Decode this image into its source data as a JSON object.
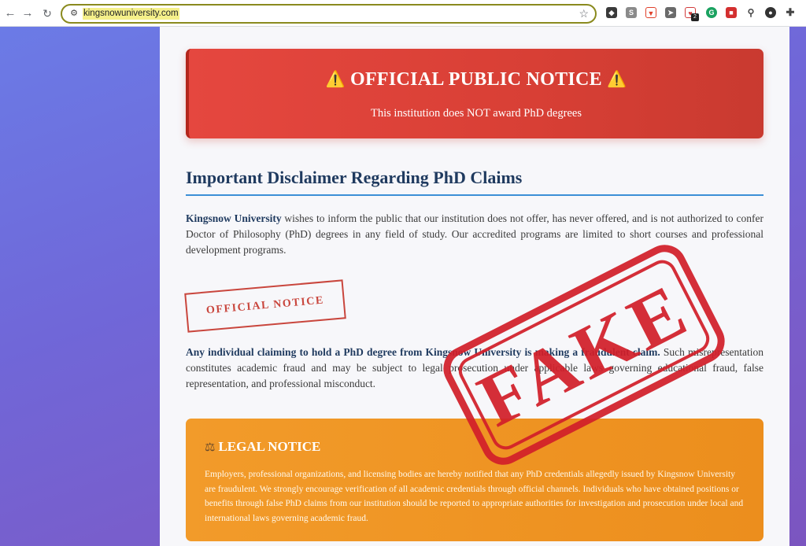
{
  "browser": {
    "url": "kingsnowuniversity.com",
    "extension_badge": "2"
  },
  "banner": {
    "title": "OFFICIAL PUBLIC NOTICE",
    "warning_glyph": "⚠️",
    "subtitle": "This institution does NOT award PhD degrees"
  },
  "disclaimer": {
    "heading": "Important Disclaimer Regarding PhD Claims",
    "para1_bold": "Kingsnow University",
    "para1_rest": " wishes to inform the public that our institution does not offer, has never offered, and is not authorized to confer Doctor of Philosophy (PhD) degrees in any field of study. Our accredited programs are limited to short courses and professional development programs.",
    "para2_bold": "Any individual claiming to hold a PhD degree from Kingsnow University is making a fraudulent claim.",
    "para2_rest": " Such misrepresentation constitutes academic fraud and may be subject to legal prosecution under applicable laws governing educational fraud, false representation, and professional misconduct."
  },
  "official_stamp": {
    "label": "OFFICIAL NOTICE"
  },
  "fake_stamp": {
    "label": "FAKE",
    "color": "#d21f2a"
  },
  "legal": {
    "icon": "scales-icon",
    "title": "LEGAL NOTICE",
    "body": "Employers, professional organizations, and licensing bodies are hereby notified that any PhD credentials allegedly issued by Kingsnow University are fraudulent. We strongly encourage verification of all academic credentials through official channels. Individuals who have obtained positions or benefits through false PhD claims from our institution should be reported to appropriate authorities for investigation and prosecution under local and international laws governing academic fraud."
  },
  "colors": {
    "banner_red": "#e5473f",
    "heading_navy": "#1f3a5f",
    "accent_blue": "#3b8fd6",
    "legal_orange": "#f29b2a"
  }
}
